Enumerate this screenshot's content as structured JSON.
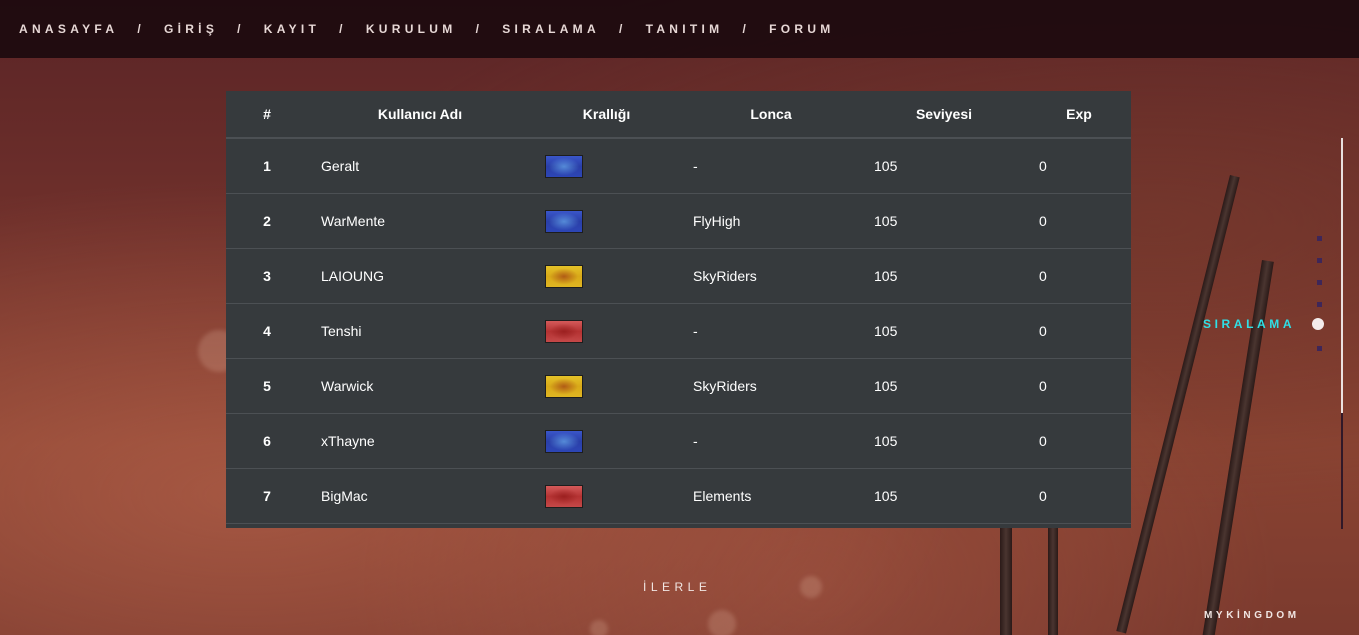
{
  "nav": {
    "items": [
      "ANASAYFA",
      "GİRİŞ",
      "KAYIT",
      "KURULUM",
      "SIRALAMA",
      "TANITIM",
      "FORUM"
    ],
    "separator": "/"
  },
  "table": {
    "headers": [
      "#",
      "Kullanıcı Adı",
      "Krallığı",
      "Lonca",
      "Seviyesi",
      "Exp"
    ],
    "rows": [
      {
        "rank": "1",
        "name": "Geralt",
        "kingdom": "blue",
        "guild": "-",
        "level": "105",
        "exp": "0"
      },
      {
        "rank": "2",
        "name": "WarMente",
        "kingdom": "blue",
        "guild": "FlyHigh",
        "level": "105",
        "exp": "0"
      },
      {
        "rank": "3",
        "name": "LAIOUNG",
        "kingdom": "yellow",
        "guild": "SkyRiders",
        "level": "105",
        "exp": "0"
      },
      {
        "rank": "4",
        "name": "Tenshi",
        "kingdom": "red",
        "guild": "-",
        "level": "105",
        "exp": "0"
      },
      {
        "rank": "5",
        "name": "Warwick",
        "kingdom": "yellow",
        "guild": "SkyRiders",
        "level": "105",
        "exp": "0"
      },
      {
        "rank": "6",
        "name": "xThayne",
        "kingdom": "blue",
        "guild": "-",
        "level": "105",
        "exp": "0"
      },
      {
        "rank": "7",
        "name": "BigMac",
        "kingdom": "red",
        "guild": "Elements",
        "level": "105",
        "exp": "0"
      }
    ]
  },
  "ilerle": "İLERLE",
  "brand": "MYKİNGDOM",
  "side_nav": {
    "active_label": "SIRALAMA",
    "active_color": "#2fe0e6"
  }
}
